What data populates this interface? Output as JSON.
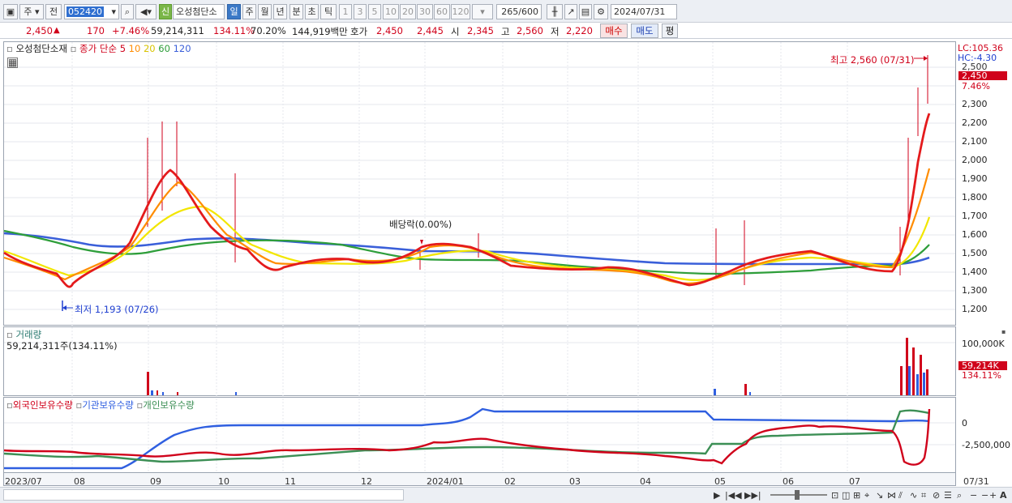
{
  "toolbar": {
    "market_type": "주",
    "prev_label": "전",
    "code": "052420",
    "new_badge": "신",
    "stock_name": "오성첨단소",
    "periods": [
      "일",
      "주",
      "월",
      "년",
      "분",
      "초",
      "틱"
    ],
    "active_period": "일",
    "intervals": [
      "1",
      "3",
      "5",
      "10",
      "20",
      "30",
      "60",
      "120"
    ],
    "count": "265",
    "count_total": "/600",
    "date": "2024/07/31"
  },
  "quote": {
    "price": "2,450",
    "arrow": "▲",
    "change": "170",
    "change_pct": "+7.46%",
    "volume": "59,214,311",
    "volume_ratio": "134.11%",
    "rate": "70.20%",
    "amount": "144,919백만",
    "ask_label": "호가",
    "ask1": "2,450",
    "ask2": "2,445",
    "open_label": "시",
    "open": "2,345",
    "high_label": "고",
    "high": "2,560",
    "low_label": "저",
    "low": "2,220",
    "buy": "매수",
    "sell": "매도",
    "eval": "평"
  },
  "legend": {
    "stock_name": "오성첨단소재",
    "close_label": "종가 단순",
    "ma_periods": [
      "5",
      "10",
      "20",
      "60",
      "120"
    ],
    "ma_colors": [
      "#e41a1c",
      "#ff8c00",
      "#f2e600",
      "#2e9e3a",
      "#3a5fd9"
    ]
  },
  "annotations": {
    "high": "최고 2,560 (07/31)",
    "low": "최저 1,193 (07/26)",
    "dividend": "배당락(0.00%)",
    "lc": "LC:105.36",
    "hc": "HC:-4.30",
    "price_tag": "2,450",
    "pct_tag": "7.46%"
  },
  "price_axis": [
    "2,500",
    "2,400",
    "2,300",
    "2,200",
    "2,100",
    "2,000",
    "1,900",
    "1,800",
    "1,700",
    "1,600",
    "1,500",
    "1,400",
    "1,300",
    "1,200"
  ],
  "volume_panel": {
    "title": "거래량",
    "value": "59,214,311주(134.11%)",
    "axis": "100,000K",
    "tag": "59,214K",
    "tag_pct": "134.11%"
  },
  "holdings_panel": {
    "series": [
      "외국인보유수량",
      "기관보유수량",
      "개인보유수량"
    ],
    "colors": [
      "#d0021b",
      "#2f5fe0",
      "#3c8f55"
    ],
    "axis": [
      "0",
      "-2,500,000"
    ]
  },
  "x_axis": [
    "2023/07",
    "08",
    "09",
    "10",
    "11",
    "12",
    "2024/01",
    "02",
    "03",
    "04",
    "05",
    "06",
    "07",
    "07/31"
  ]
}
